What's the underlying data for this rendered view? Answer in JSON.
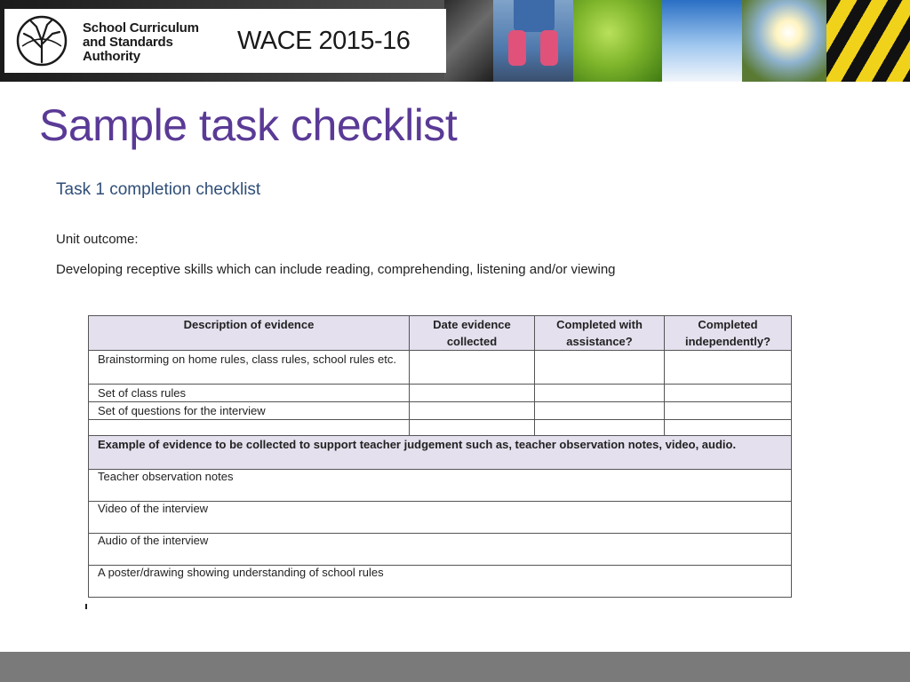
{
  "header": {
    "logo_lines": [
      "School Curriculum",
      "and Standards",
      "Authority"
    ],
    "program": "WACE 2015-16"
  },
  "slide": {
    "title": "Sample task checklist"
  },
  "document": {
    "heading": "Task 1 completion checklist",
    "unit_outcome_label": "Unit outcome:",
    "unit_outcome_text": "Developing receptive skills which can include reading,  comprehending,  listening and/or viewing"
  },
  "table": {
    "headers": [
      "Description of evidence",
      "Date evidence collected",
      "Completed with assistance?",
      "Completed independently?"
    ],
    "rows": [
      "Brainstorming  on home rules, class rules, school rules etc.",
      "Set of class rules",
      "Set of questions for the interview",
      ""
    ],
    "example_header": "Example of evidence to be collected to support teacher judgement such as, teacher observation notes, video, audio.",
    "examples": [
      "Teacher observation notes",
      "Video of the interview",
      "Audio of the interview",
      "A poster/drawing showing understanding of school rules"
    ]
  },
  "colors": {
    "title": "#5a3a96",
    "heading": "#2f4e78",
    "header_fill": "#e4e0ee",
    "footer": "#7a7a7a"
  }
}
